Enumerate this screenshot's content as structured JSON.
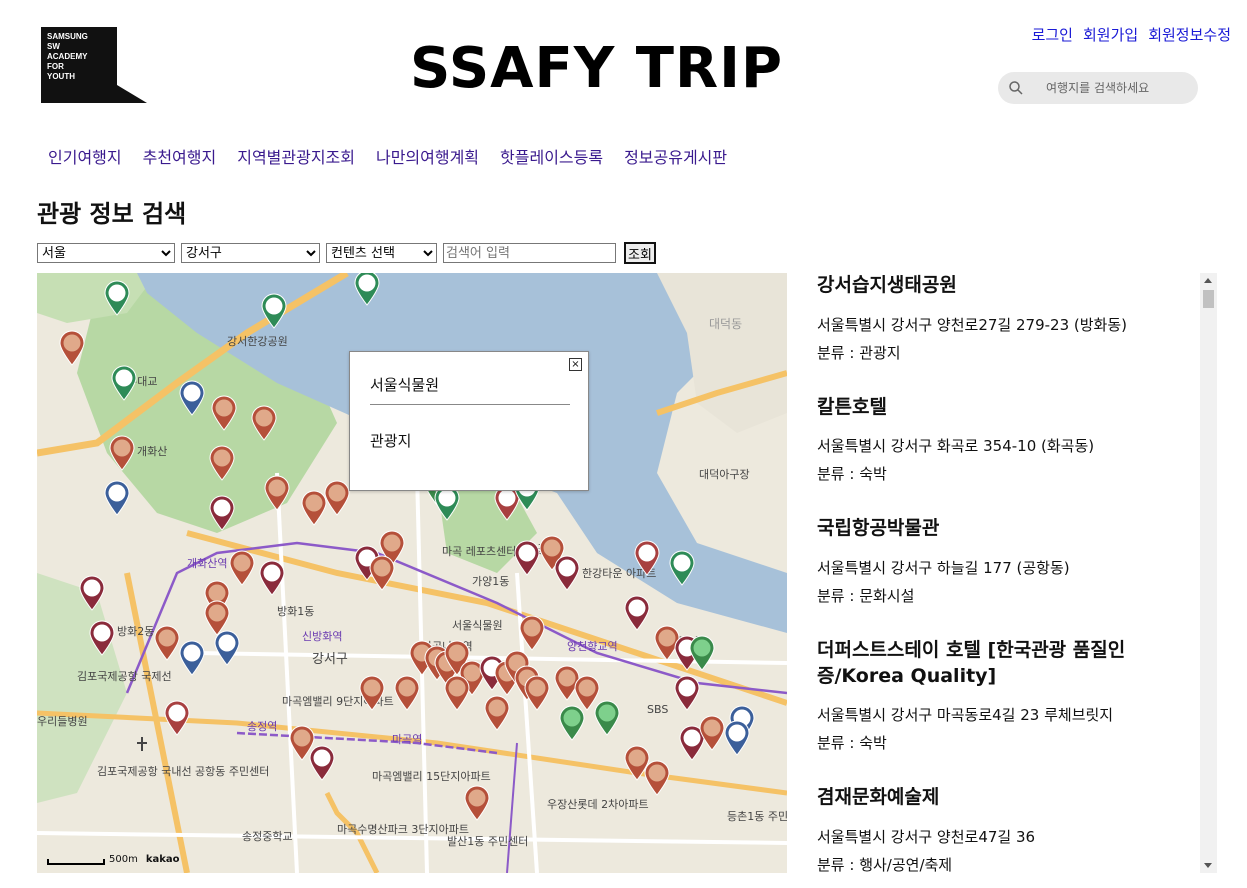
{
  "logo_text": [
    "SAMSUNG",
    "SW",
    "ACADEMY",
    "FOR",
    "YOUTH"
  ],
  "site_title": "SSAFY TRIP",
  "top_links": {
    "login": "로그인",
    "signup": "회원가입",
    "edit_profile": "회원정보수정"
  },
  "search": {
    "placeholder": "여행지를 검색하세요"
  },
  "nav": [
    "인기여행지",
    "추천여행지",
    "지역별관광지조회",
    "나만의여행계획",
    "핫플레이스등록",
    "정보공유게시판"
  ],
  "section_title": "관광 정보 검색",
  "filters": {
    "sido": "서울",
    "gugun": "강서구",
    "content_type": "컨텐츠 선택",
    "keyword_placeholder": "검색어 입력",
    "submit_label": "조회"
  },
  "map": {
    "popup": {
      "title": "서울식물원",
      "category": "관광지",
      "close": "×"
    },
    "scale_label": "500m",
    "provider": "kakao",
    "labels": [
      "개화산",
      "강서구",
      "마곡나루역",
      "서울식물원",
      "김포국제공항 국내선",
      "김포국제공항 국제선",
      "공항동 주민센터",
      "발산1동 주민센터",
      "가양1동",
      "가양2동",
      "등촌1동 주민센터",
      "우장산롯데 2차아파트",
      "마곡수명산파크 3단지아파트",
      "마곡엠밸리 15단지아파트",
      "마곡엠밸리 9단지아파트",
      "마곡 레포츠센터",
      "SBS",
      "대덕동",
      "대덕아구장",
      "우리들병원",
      "송정중학교",
      "신방화역",
      "마곡역",
      "송정역",
      "양천향교역",
      "개화산역",
      "궁산",
      "한강타운 아파트",
      "강서한강공원",
      "방화1동",
      "행주대교",
      "방화2동"
    ],
    "colors": {
      "water": "#a7c1d9",
      "park": "#b7d8a4",
      "land": "#ede9dd",
      "road_major": "#f5c266",
      "road_minor": "#ffffff",
      "subway": "#8c5ac8"
    }
  },
  "results": [
    {
      "title": "강서습지생태공원",
      "address": "서울특별시 강서구 양천로27길 279-23 (방화동)",
      "category": "분류 : 관광지"
    },
    {
      "title": "칼튼호텔",
      "address": "서울특별시 강서구 화곡로 354-10 (화곡동)",
      "category": "분류 : 숙박"
    },
    {
      "title": "국립항공박물관",
      "address": "서울특별시 강서구 하늘길 177 (공항동)",
      "category": "분류 : 문화시설"
    },
    {
      "title": "더퍼스트스테이 호텔 [한국관광 품질인증/Korea Quality]",
      "address": "서울특별시 강서구 마곡동로4길 23 루체브릿지",
      "category": "분류 : 숙박"
    },
    {
      "title": "겸재문화예술제",
      "address": "서울특별시 강서구 양천로47길 36",
      "category": "분류 : 행사/공연/축제"
    }
  ]
}
